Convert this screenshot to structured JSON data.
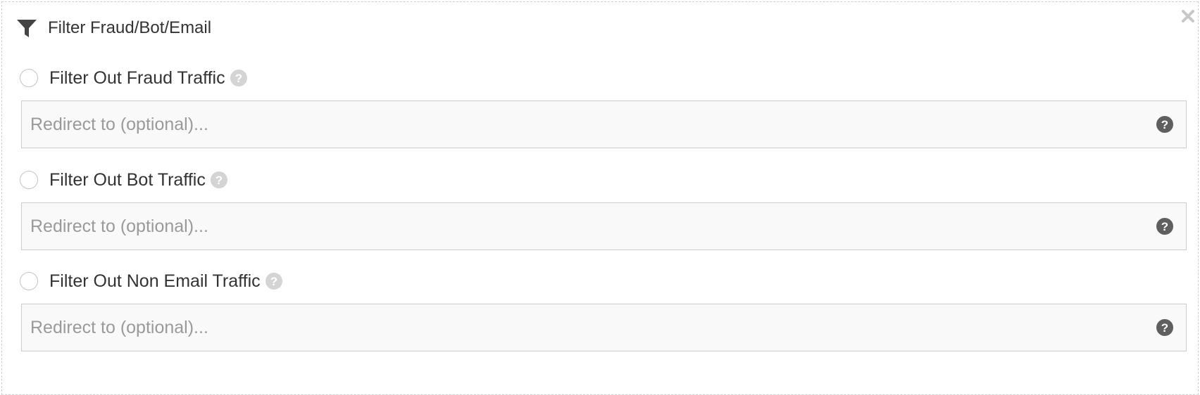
{
  "panel": {
    "title": "Filter Fraud/Bot/Email",
    "icon": "filter-icon",
    "close_icon": "close-icon"
  },
  "options": [
    {
      "label": "Filter Out Fraud Traffic",
      "selected": false,
      "redirect_placeholder": "Redirect to (optional)...",
      "redirect_value": ""
    },
    {
      "label": "Filter Out Bot Traffic",
      "selected": false,
      "redirect_placeholder": "Redirect to (optional)...",
      "redirect_value": ""
    },
    {
      "label": "Filter Out Non Email Traffic",
      "selected": false,
      "redirect_placeholder": "Redirect to (optional)...",
      "redirect_value": ""
    }
  ],
  "colors": {
    "text": "#333333",
    "placeholder": "#9a9a9a",
    "input_background": "#f9f9f9",
    "input_border": "#cccccc",
    "help_icon_light": "#d4d4d4",
    "help_icon_dark": "#5f5f5f",
    "close_icon": "#c8c8c8"
  }
}
